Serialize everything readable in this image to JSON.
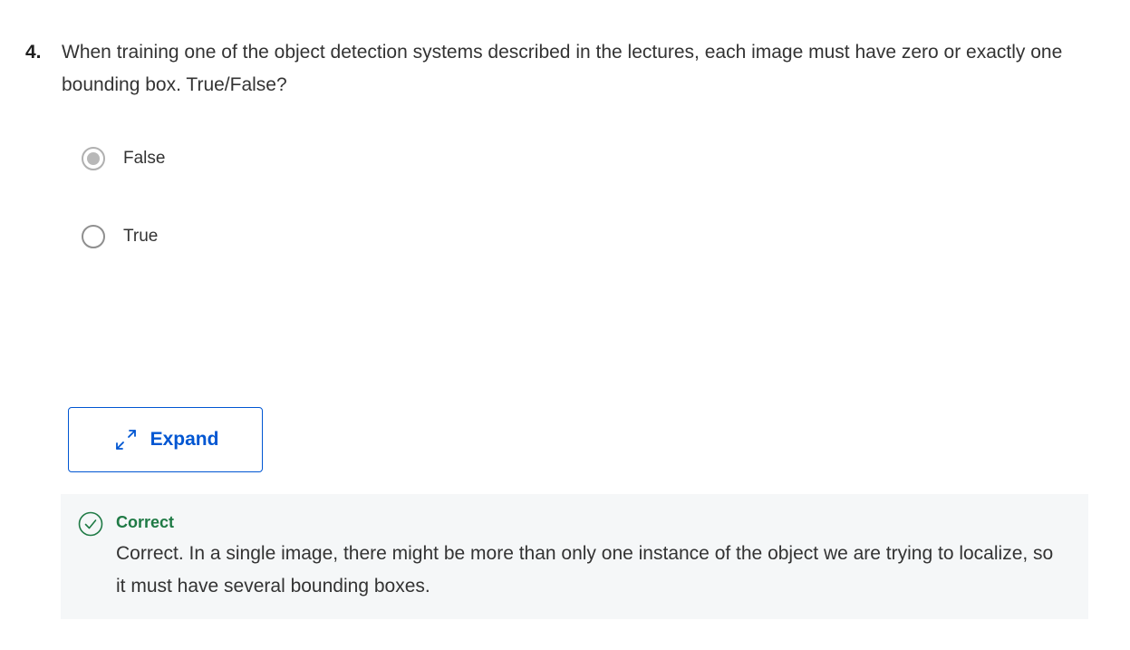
{
  "question": {
    "number": "4.",
    "text": "When training one of the object detection systems described in the lectures, each image must have zero or exactly one bounding box. True/False?"
  },
  "options": [
    {
      "label": "False",
      "selected": true
    },
    {
      "label": "True",
      "selected": false
    }
  ],
  "expand_button": {
    "label": "Expand",
    "icon": "expand-arrows-icon"
  },
  "feedback": {
    "status": "Correct",
    "icon": "check-circle-icon",
    "text": "Correct. In a single image, there might be more than only one instance of the object we are trying to localize, so it must have several bounding boxes."
  },
  "colors": {
    "accent": "#0056d2",
    "correct": "#1f7a45",
    "feedback_bg": "#f5f7f8"
  }
}
